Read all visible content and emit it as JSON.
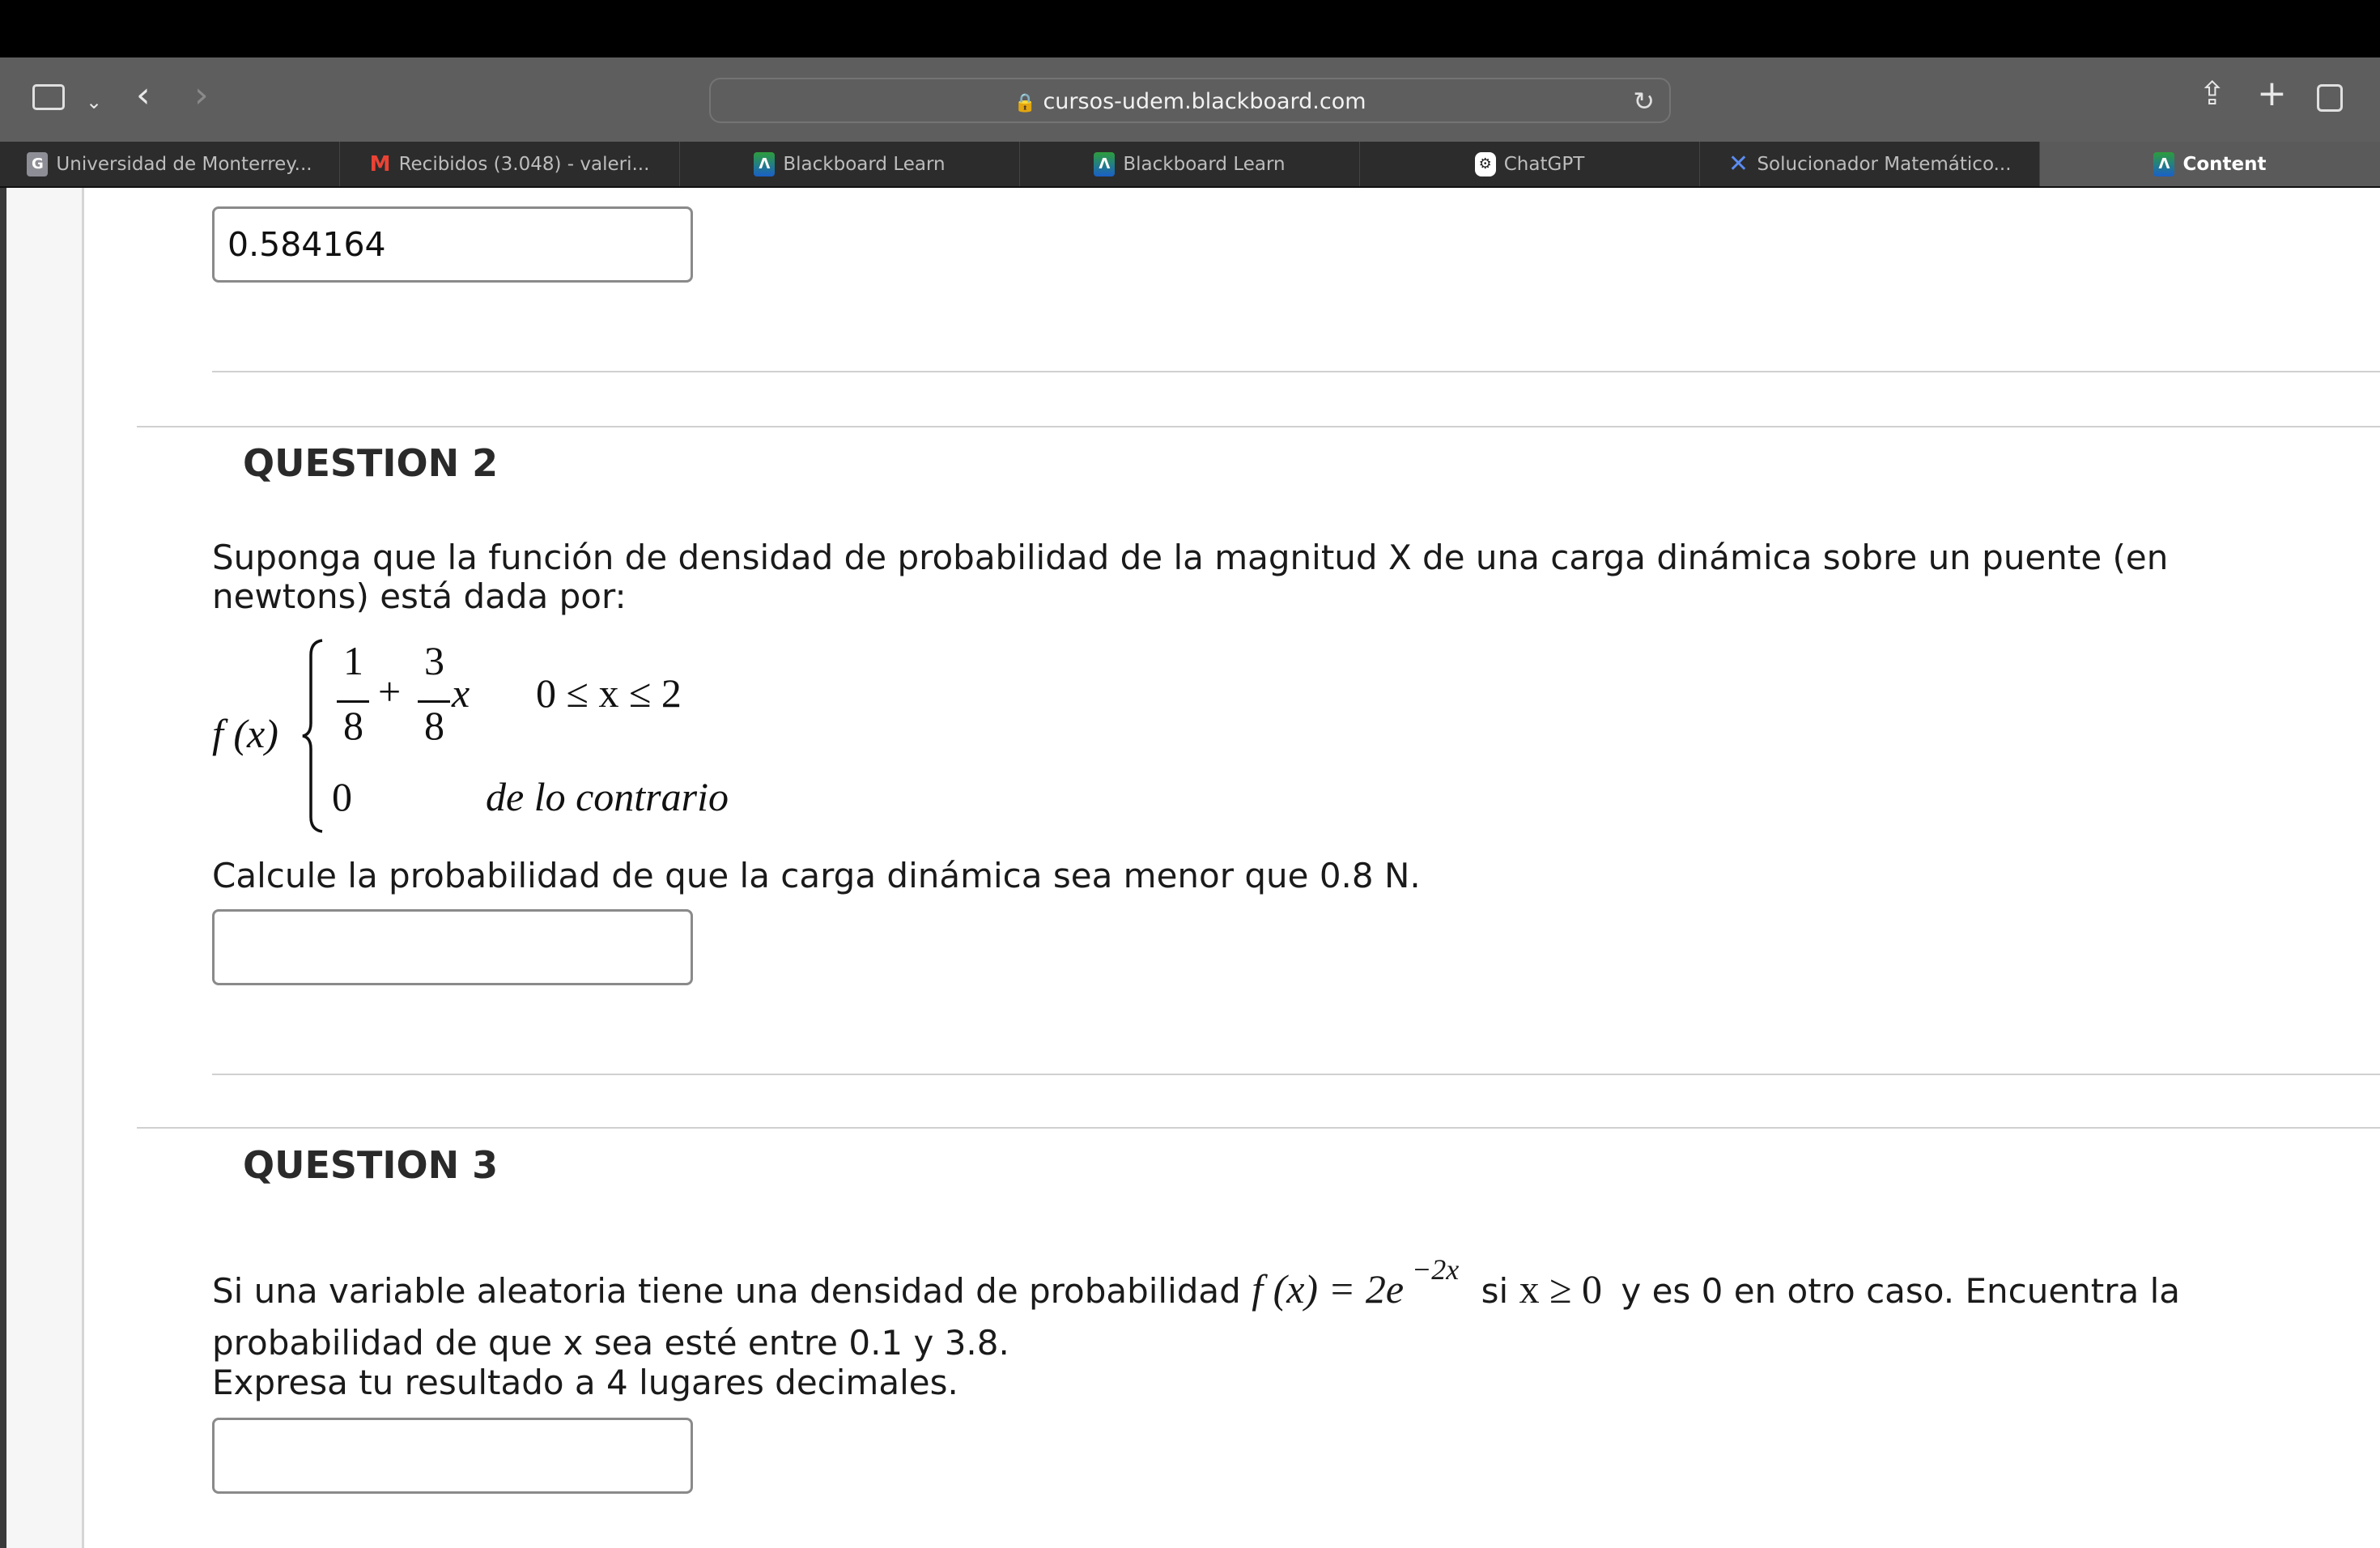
{
  "browser": {
    "url": "cursos-udem.blackboard.com",
    "icons": [
      "sidebar-icon",
      "chevron-down-icon",
      "back-icon",
      "forward-icon",
      "lock-icon",
      "reload-icon",
      "share-icon",
      "new-tab-icon",
      "tab-overview-icon"
    ],
    "tabs": [
      {
        "label": "Universidad de Monterrey...",
        "icon": "google-g-icon",
        "color": "#8e8e96"
      },
      {
        "label": "Recibidos (3.048) - valeri...",
        "icon": "gmail-icon",
        "color": "#ea4335"
      },
      {
        "label": "Blackboard Learn",
        "icon": "blackboard-icon",
        "color": "#1a73c8"
      },
      {
        "label": "Blackboard Learn",
        "icon": "blackboard-icon",
        "color": "#1a73c8"
      },
      {
        "label": "ChatGPT",
        "icon": "chatgpt-icon",
        "color": "#ffffff"
      },
      {
        "label": "Solucionador Matemático...",
        "icon": "microsoft-math-icon",
        "color": "#5b6cf0"
      },
      {
        "label": "Content",
        "icon": "blackboard-icon",
        "color": "#1a73c8",
        "active": true
      }
    ]
  },
  "q1": {
    "answer": "0.584164"
  },
  "q2": {
    "title": "QUESTION 2",
    "text": "Suponga que la función de densidad de probabilidad de la magnitud X de una carga dinámica sobre un puente (en newtons) está dada por:",
    "formula": {
      "lhs": "f (x)",
      "num1": "1",
      "den1": "8",
      "plus": "+",
      "num2": "3",
      "den2": "8",
      "var": "x",
      "cond1": "0 ≤ x ≤ 2",
      "case2": "0",
      "cond2": "de lo contrario"
    },
    "question": "Calcule la probabilidad de que la carga dinámica sea menor que 0.8 N.",
    "answer": ""
  },
  "q3": {
    "title": "QUESTION 3",
    "text_a": "Si una variable aleatoria tiene una densidad de probabilidad ",
    "math1": "f (x) = 2e",
    "exp": "−2x",
    "text_b": " si ",
    "math2": "x ≥ 0",
    "text_c": " y es 0 en otro caso. Encuentra la probabilidad de que x sea esté entre 0.1 y 3.8.",
    "text_d": "Expresa tu resultado a 4 lugares decimales.",
    "answer": ""
  }
}
